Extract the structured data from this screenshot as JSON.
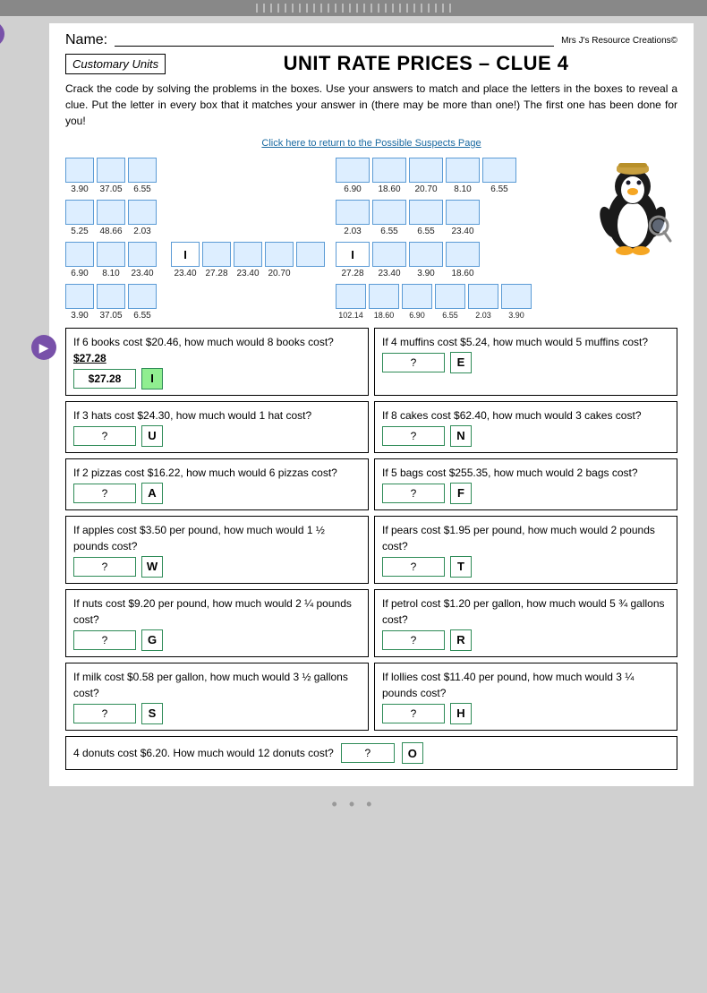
{
  "topBars": 28,
  "page": {
    "name_label": "Name:",
    "copyright": "Mrs J's Resource Creations©",
    "tag": "Customary Units",
    "title": "UNIT RATE PRICES – CLUE 4",
    "instructions": "Crack the code by solving the problems in the boxes. Use your answers to match and place the letters in the boxes to reveal a clue.  Put the letter in every box that it matches  your answer in (there may be more than one!) The first one has been done for you!",
    "link": "Click here to return to the Possible Suspects Page"
  },
  "codeRows": {
    "left": [
      {
        "cells": 3,
        "labels": [
          "3.90",
          "37.05",
          "6.55"
        ]
      },
      {
        "cells": 3,
        "labels": [
          "5.25",
          "48.66",
          "2.03"
        ]
      },
      {
        "cells": 5,
        "labels": [
          "6.90",
          "8.10",
          "23.40",
          "23.40",
          "27.28"
        ],
        "letterCell": 2,
        "letterValue": "I"
      },
      {
        "cells": 3,
        "labels": [
          "3.90",
          "37.05",
          "6.55"
        ]
      }
    ],
    "right": [
      {
        "cells": 5,
        "labels": [
          "6.90",
          "18.60",
          "20.70",
          "8.10",
          "6.55"
        ]
      },
      {
        "cells": 4,
        "labels": [
          "2.03",
          "6.55",
          "6.55",
          "23.40"
        ]
      },
      {
        "cells": 5,
        "labels": [
          "23.40",
          "20.70",
          "27.28",
          "23.40",
          "3.90"
        ],
        "letterCell": 0,
        "letterValue": "I",
        "extraLabel": "18.60"
      },
      {
        "cells": 6,
        "labels": [
          "102.14",
          "18.60",
          "6.90",
          "6.55",
          "2.03",
          "3.90"
        ]
      }
    ]
  },
  "problems": [
    {
      "text": "If 6 books cost $20.46, how much would 8 books cost?",
      "answer": "$27.28",
      "letter": "I",
      "letterHighlight": true,
      "hasAnswer": true
    },
    {
      "text": "If 4 muffins cost $5.24, how much would 5 muffins cost?",
      "answer": "?",
      "letter": "E",
      "letterHighlight": false,
      "hasAnswer": false
    },
    {
      "text": "If 3 hats cost $24.30, how much would 1 hat cost?",
      "answer": "?",
      "letter": "U",
      "letterHighlight": false,
      "hasAnswer": false
    },
    {
      "text": "If 8 cakes cost $62.40, how much would 3 cakes cost?",
      "answer": "?",
      "letter": "N",
      "letterHighlight": false,
      "hasAnswer": false
    },
    {
      "text": "If 2 pizzas cost $16.22, how much would 6 pizzas cost?",
      "answer": "?",
      "letter": "A",
      "letterHighlight": false,
      "hasAnswer": false
    },
    {
      "text": "If 5 bags cost $255.35, how much would 2 bags cost?",
      "answer": "?",
      "letter": "F",
      "letterHighlight": false,
      "hasAnswer": false
    },
    {
      "text": "If apples cost $3.50 per pound, how much would 1 ½ pounds cost?",
      "answer": "?",
      "letter": "W",
      "letterHighlight": false,
      "hasAnswer": false
    },
    {
      "text": "If pears cost $1.95 per pound, how much would 2 pounds cost?",
      "answer": "?",
      "letter": "T",
      "letterHighlight": false,
      "hasAnswer": false
    },
    {
      "text": "If nuts cost $9.20 per pound, how much would 2 ¼ pounds cost?",
      "answer": "?",
      "letter": "G",
      "letterHighlight": false,
      "hasAnswer": false
    },
    {
      "text": "If petrol cost $1.20 per gallon, how much would 5 ¾ gallons cost?",
      "answer": "?",
      "letter": "R",
      "letterHighlight": false,
      "hasAnswer": false
    },
    {
      "text": "If milk cost $0.58 per gallon, how much would 3 ½ gallons cost?",
      "answer": "?",
      "letter": "S",
      "letterHighlight": false,
      "hasAnswer": false
    },
    {
      "text": "If lollies cost $11.40 per pound, how much would 3 ¼ pounds cost?",
      "answer": "?",
      "letter": "H",
      "letterHighlight": false,
      "hasAnswer": false
    }
  ],
  "bottomProblem": {
    "text": "4 donuts cost $6.20. How much would 12 donuts cost?",
    "answer": "?",
    "letter": "O"
  },
  "icons": {
    "speaker": "▶",
    "three_dots": "• • •"
  }
}
